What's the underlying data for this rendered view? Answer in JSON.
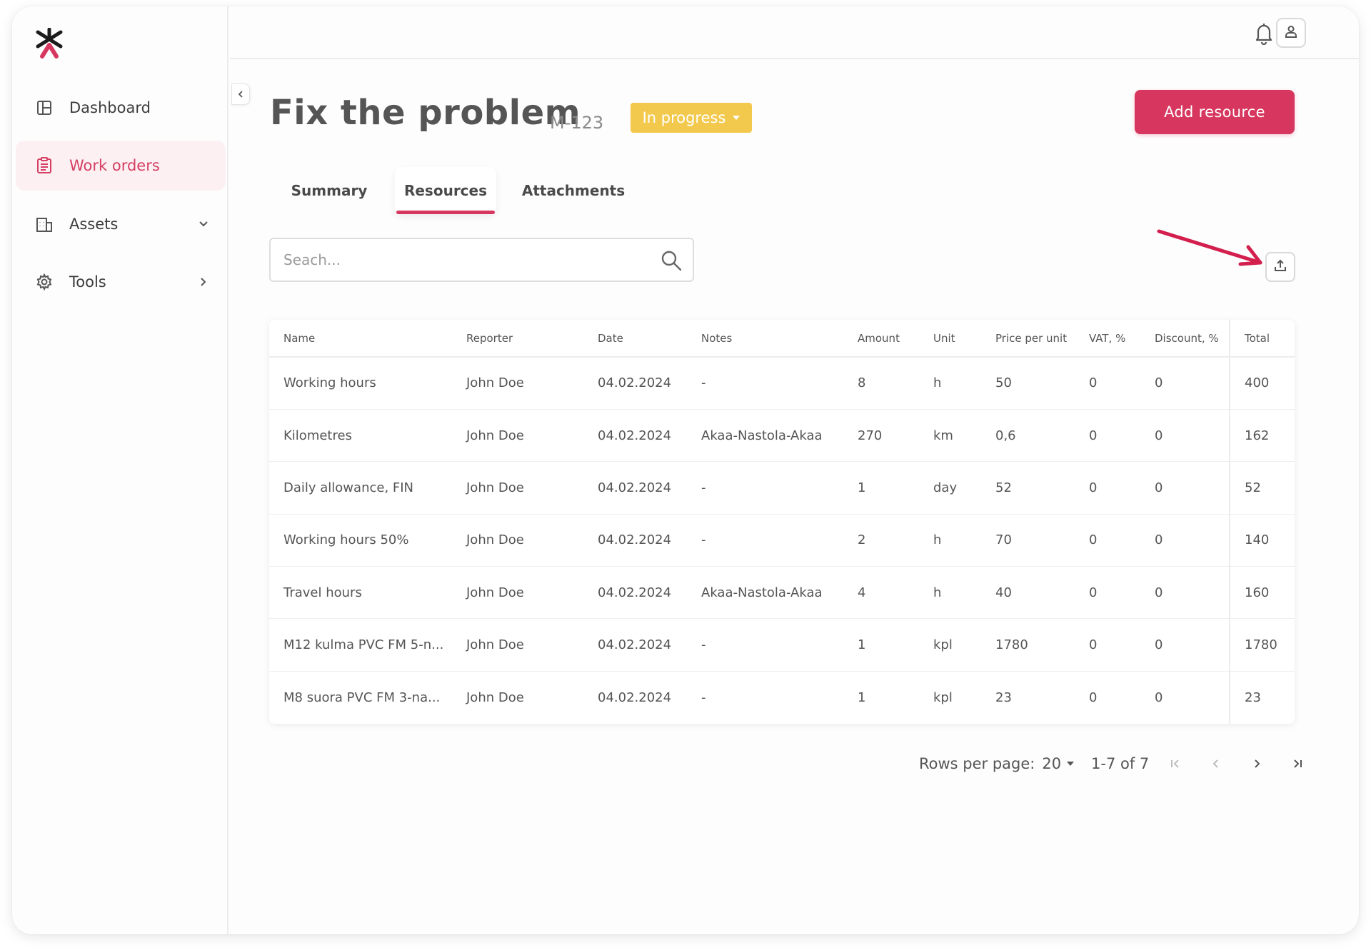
{
  "sidebar": {
    "items": [
      {
        "label": "Dashboard",
        "icon": "dashboard-icon",
        "active": false
      },
      {
        "label": "Work orders",
        "icon": "clipboard-icon",
        "active": true
      },
      {
        "label": "Assets",
        "icon": "building-icon",
        "chevron": "down"
      },
      {
        "label": "Tools",
        "icon": "gear-icon",
        "chevron": "right"
      }
    ]
  },
  "header": {
    "title": "Fix the problem",
    "work_order_id": "M-123",
    "status": "In progress",
    "add_button": "Add resource"
  },
  "tabs": [
    {
      "label": "Summary",
      "active": false
    },
    {
      "label": "Resources",
      "active": true
    },
    {
      "label": "Attachments",
      "active": false
    }
  ],
  "search": {
    "placeholder": "Seach..."
  },
  "table": {
    "columns": [
      "Name",
      "Reporter",
      "Date",
      "Notes",
      "Amount",
      "Unit",
      "Price per unit",
      "VAT, %",
      "Discount, %",
      "Total"
    ],
    "rows": [
      [
        "Working hours",
        "John Doe",
        "04.02.2024",
        "-",
        "8",
        "h",
        "50",
        "0",
        "0",
        "400"
      ],
      [
        "Kilometres",
        "John Doe",
        "04.02.2024",
        "Akaa-Nastola-Akaa",
        "270",
        "km",
        "0,6",
        "0",
        "0",
        "162"
      ],
      [
        "Daily allowance, FIN",
        "John Doe",
        "04.02.2024",
        "-",
        "1",
        "day",
        "52",
        "0",
        "0",
        "52"
      ],
      [
        "Working hours 50%",
        "John Doe",
        "04.02.2024",
        "-",
        "2",
        "h",
        "70",
        "0",
        "0",
        "140"
      ],
      [
        "Travel hours",
        "John Doe",
        "04.02.2024",
        "Akaa-Nastola-Akaa",
        "4",
        "h",
        "40",
        "0",
        "0",
        "160"
      ],
      [
        "M12 kulma PVC FM 5-n...",
        "John Doe",
        "04.02.2024",
        "-",
        "1",
        "kpl",
        "1780",
        "0",
        "0",
        "1780"
      ],
      [
        "M8 suora PVC FM 3-na...",
        "John Doe",
        "04.02.2024",
        "-",
        "1",
        "kpl",
        "23",
        "0",
        "0",
        "23"
      ]
    ]
  },
  "pagination": {
    "rows_per_page_label": "Rows per page:",
    "rows_per_page": "20",
    "range": "1-7 of 7"
  },
  "colors": {
    "accent": "#d7375f",
    "status": "#f2c94c",
    "active_nav_bg": "#fdf0f2"
  }
}
